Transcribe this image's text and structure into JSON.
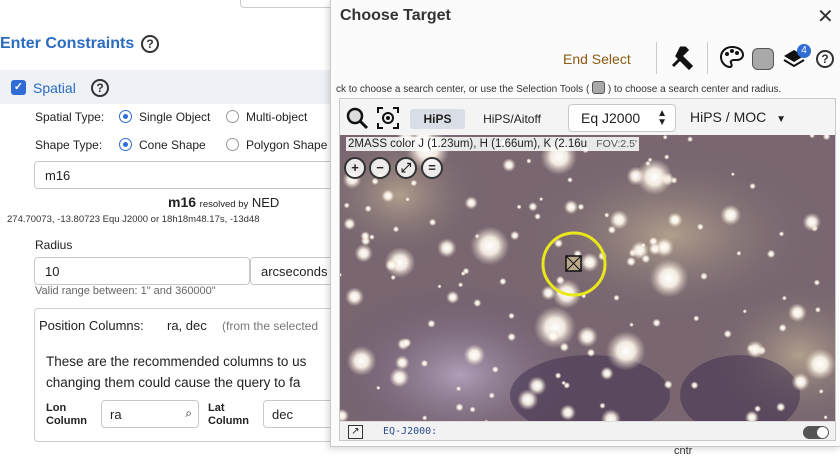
{
  "constraints": {
    "title": "Enter Constraints",
    "spatial_label": "Spatial",
    "spatial_type_label": "Spatial Type:",
    "spatial_type_options": [
      "Single Object",
      "Multi-object"
    ],
    "shape_type_label": "Shape Type:",
    "shape_type_options": [
      "Cone Shape",
      "Polygon Shape"
    ],
    "target_value": "m16",
    "resolved_name": "m16",
    "resolved_by": "resolved by",
    "resolver": "NED",
    "coords_text": "274.70073, -13.80723  Equ J2000    or    18h18m48.17s, -13d48",
    "radius_label": "Radius",
    "radius_value": "10",
    "radius_unit": "arcseconds",
    "radius_hint": "Valid range between: 1\" and 360000\"",
    "poscol_label": "Position Columns:",
    "poscol_value": "ra, dec",
    "poscol_note": "(from the selected",
    "poscol_desc1": "These are the recommended columns to us",
    "poscol_desc2": "changing them could cause the query to fa",
    "lon_label_1": "Lon",
    "lon_label_2": "Column",
    "lon_value": "ra",
    "lat_label_1": "Lat",
    "lat_label_2": "Column",
    "lat_value": "dec",
    "cntr_text": "cntr"
  },
  "dialog": {
    "title": "Choose Target",
    "end_select": "End Select",
    "badge_count": "4",
    "instructions_pre": "ck to choose a search center, or use the Selection Tools (",
    "instructions_post": ") to choose a search center and radius.",
    "tabs": [
      "HiPS",
      "HiPS/Aitoff"
    ],
    "coord_system": "Eq J2000",
    "moc_menu": "HiPS / MOC",
    "image_title": "2MASS color J (1.23um), H (1.66um), K (2.16u",
    "fov": "FOV:2.5'",
    "readout": "EQ-J2000:",
    "icons": [
      "close-icon",
      "tools-icon",
      "palette-icon",
      "selection-tool-icon",
      "layers-icon",
      "help-icon",
      "search-icon",
      "recenter-icon",
      "zoom-in-icon",
      "zoom-out-icon",
      "zoom-fit-icon",
      "zoom-fill-icon",
      "expand-icon"
    ]
  },
  "colors": {
    "accent": "#2a6cc0",
    "end_select": "#8a5a10",
    "marker": "#e8e81a"
  }
}
